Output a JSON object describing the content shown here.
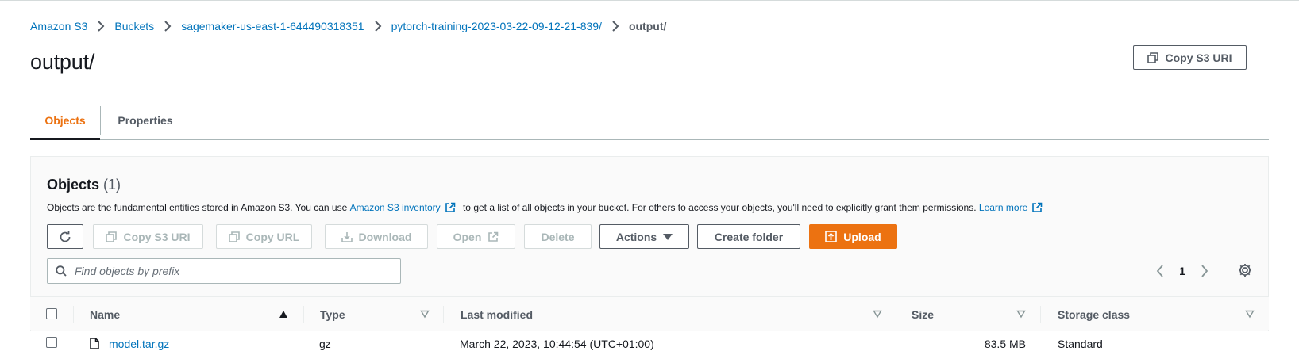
{
  "breadcrumb": {
    "items": [
      "Amazon S3",
      "Buckets",
      "sagemaker-us-east-1-644490318351",
      "pytorch-training-2023-03-22-09-12-21-839/"
    ],
    "current": "output/"
  },
  "page": {
    "title": "output/",
    "copy_s3_uri_label": "Copy S3 URI"
  },
  "tabs": [
    {
      "label": "Objects",
      "active": true
    },
    {
      "label": "Properties",
      "active": false
    }
  ],
  "objects_panel": {
    "title": "Objects",
    "count": "(1)",
    "description_before": "Objects are the fundamental entities stored in Amazon S3. You can use ",
    "inventory_link": "Amazon S3 inventory",
    "description_after": " to get a list of all objects in your bucket. For others to access your objects, you'll need to explicitly grant them permissions. ",
    "learn_more": "Learn more"
  },
  "toolbar": {
    "copy_s3_uri": "Copy S3 URI",
    "copy_url": "Copy URL",
    "download": "Download",
    "open": "Open",
    "delete": "Delete",
    "actions": "Actions",
    "create_folder": "Create folder",
    "upload": "Upload"
  },
  "search": {
    "placeholder": "Find objects by prefix"
  },
  "pagination": {
    "current_page": "1"
  },
  "table": {
    "columns": [
      "Name",
      "Type",
      "Last modified",
      "Size",
      "Storage class"
    ],
    "rows": [
      {
        "name": "model.tar.gz",
        "type": "gz",
        "last_modified": "March 22, 2023, 10:44:54 (UTC+01:00)",
        "size": "83.5 MB",
        "storage_class": "Standard"
      }
    ]
  },
  "colors": {
    "link": "#0073bb",
    "accent": "#ec7211",
    "text": "#16191f",
    "muted": "#545b64",
    "disabled": "#aab7b8"
  }
}
